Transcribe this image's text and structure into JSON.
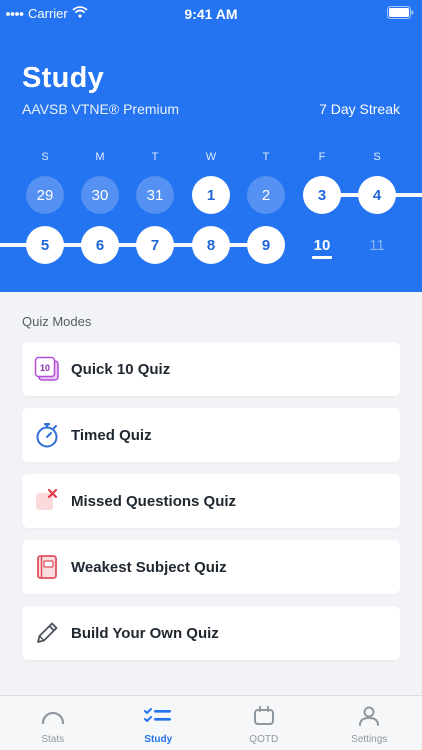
{
  "status_bar": {
    "carrier": "Carrier",
    "time": "9:41 AM"
  },
  "header": {
    "title": "Study",
    "subtitle": "AAVSB VTNE® Premium",
    "streak": "7 Day Streak"
  },
  "calendar": {
    "weekdays": [
      "S",
      "M",
      "T",
      "W",
      "T",
      "F",
      "S"
    ],
    "week1": [
      "29",
      "30",
      "31",
      "1",
      "2",
      "3",
      "4"
    ],
    "week2": [
      "5",
      "6",
      "7",
      "8",
      "9",
      "10",
      "11"
    ]
  },
  "quiz_modes": {
    "label": "Quiz Modes",
    "items": [
      {
        "label": "Quick 10 Quiz",
        "icon": "quick-10-icon",
        "icon_text": "10"
      },
      {
        "label": "Timed Quiz",
        "icon": "stopwatch-icon"
      },
      {
        "label": "Missed Questions Quiz",
        "icon": "missed-x-icon"
      },
      {
        "label": "Weakest Subject Quiz",
        "icon": "notebook-icon"
      },
      {
        "label": "Build Your Own Quiz",
        "icon": "pencil-icon"
      }
    ]
  },
  "tabs": [
    {
      "label": "Stats",
      "icon": "gauge-icon",
      "active": false
    },
    {
      "label": "Study",
      "icon": "checklist-icon",
      "active": true
    },
    {
      "label": "QOTD",
      "icon": "calendar-icon",
      "active": false
    },
    {
      "label": "Settings",
      "icon": "person-icon",
      "active": false
    }
  ],
  "colors": {
    "primary": "#2473f0",
    "background": "#f2f3f6"
  }
}
